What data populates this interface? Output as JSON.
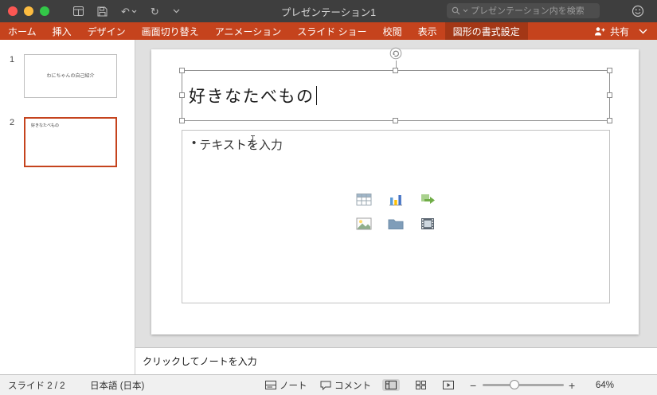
{
  "colors": {
    "ribbon_red": "#C5431D",
    "ribbon_active_red": "#A33716",
    "selected_slide_border": "#C5431D",
    "titlebar_bg": "#3E3E3E"
  },
  "titlebar": {
    "title": "プレゼンテーション1",
    "search_placeholder": "プレゼンテーション内を検索"
  },
  "ribbon": {
    "tabs": [
      "ホーム",
      "挿入",
      "デザイン",
      "画面切り替え",
      "アニメーション",
      "スライド ショー",
      "校閲",
      "表示",
      "図形の書式設定"
    ],
    "active_tab": "図形の書式設定",
    "share_label": "共有"
  },
  "slides_panel": {
    "slides": [
      {
        "number": "1",
        "title": "わにちゃんの自己紹介"
      },
      {
        "number": "2",
        "title": "好きなたべもの"
      }
    ]
  },
  "slide": {
    "title_text": "好きなたべもの",
    "bullet": "•",
    "body_placeholder": "テキストを入力"
  },
  "notes": {
    "placeholder": "クリックしてノートを入力"
  },
  "statusbar": {
    "slide_counter": "スライド 2 / 2",
    "language": "日本語 (日本)",
    "notes_label": "ノート",
    "comments_label": "コメント",
    "zoom_minus": "−",
    "zoom_plus": "+",
    "zoom_level": "64%"
  }
}
